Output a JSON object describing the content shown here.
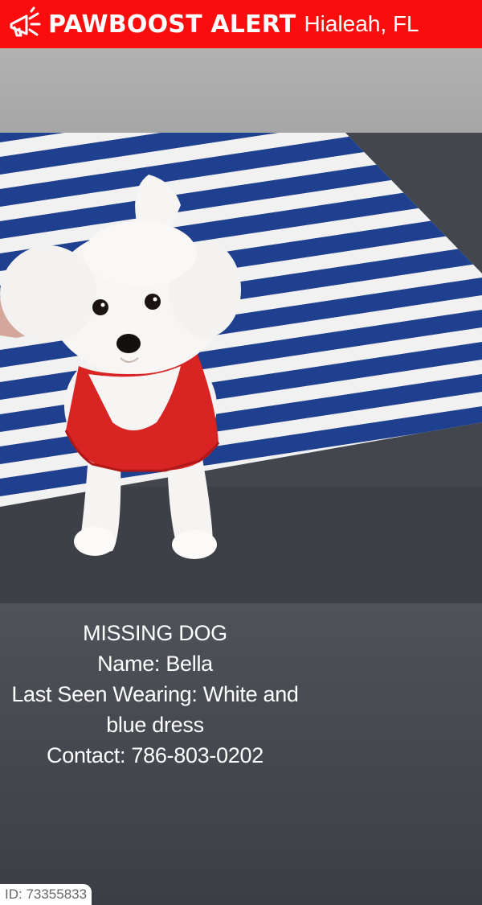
{
  "header": {
    "brand": "PAWBOOST ALERT",
    "location": "Hialeah, FL",
    "icon": "megaphone-icon",
    "background": "#fb0d0d"
  },
  "photo": {
    "subject": "",
    "rug_colors": [
      "#1f3a8a",
      "#f2f2f2"
    ]
  },
  "info": {
    "status": "MISSING DOG",
    "name": "Name: Bella",
    "wearing_line1": "Last Seen Wearing: White and",
    "wearing_line2": "blue dress",
    "contact": "Contact: 786-803-0202"
  },
  "footer": {
    "id": "ID: 73355833"
  }
}
